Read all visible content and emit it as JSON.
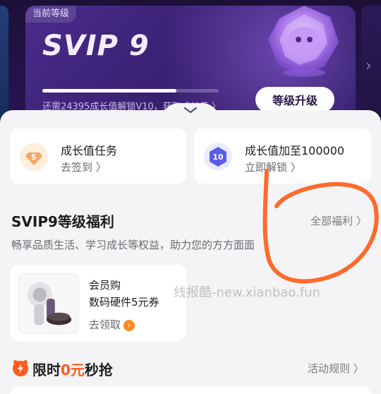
{
  "vip_card": {
    "level_tag": "当前等级",
    "level_title": "SVIP 9",
    "progress_text": "还需24395成长值解锁V10，获取成长值 〉",
    "progress_fraction": 0.76,
    "upgrade_button": "等级升级"
  },
  "tasks": [
    {
      "title": "成长值任务",
      "subtitle": "去签到 〉",
      "icon": "growth-gem-icon",
      "color": "#f0a35c"
    },
    {
      "title": "成长值加至100000",
      "subtitle": "立即解锁 〉",
      "icon": "level-10-badge-icon",
      "color": "#5a5be8"
    }
  ],
  "benefits_section": {
    "title": "SVIP9等级福利",
    "link": "全部福利 〉",
    "description": "畅享品质生活、学习成长等权益，助力您的方方面面"
  },
  "benefit_card": {
    "name": "会员购",
    "description": "数码硬件5元券",
    "claim": "去领取",
    "claim_arrow": "›"
  },
  "watermark": "线报酷-new.xianbao.fun",
  "flash_sale": {
    "title_prefix": "限时",
    "title_highlight": "0元",
    "title_suffix": "秒抢",
    "link": "活动规则 〉"
  },
  "colors": {
    "accent_orange": "#ff5a1f",
    "annotation_orange": "#ff6a2a",
    "card_purple": "#3a2172"
  }
}
